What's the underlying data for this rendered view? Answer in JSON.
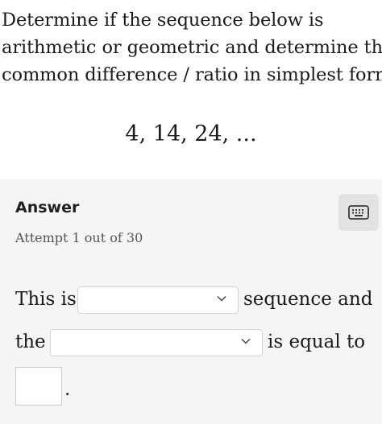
{
  "question": {
    "line1": "Determine if the sequence below is",
    "line2": "arithmetic or geometric and determine the",
    "line3": "common difference / ratio in simplest form"
  },
  "sequence": "4, 14, 24, ...",
  "answer": {
    "title": "Answer",
    "attempt": "Attempt 1 out of 30",
    "keyboard_icon": "keyboard-icon",
    "line1_prefix": "This is",
    "line1_suffix": "sequence and",
    "line2_prefix": "the",
    "line2_suffix": "is equal to",
    "select1_value": "",
    "select2_value": "",
    "input_value": "",
    "terminal_period": "."
  },
  "colors": {
    "panel_bg": "#f5f5f5",
    "keyboard_btn_bg": "#e2e2e2",
    "text": "#1a1a1a"
  }
}
